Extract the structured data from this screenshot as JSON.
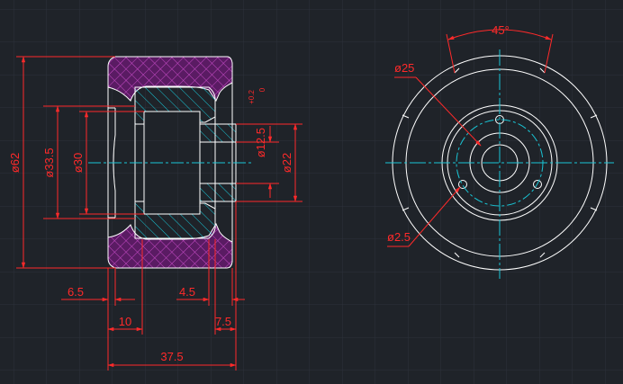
{
  "drawing": {
    "colors": {
      "background": "#1f2329",
      "grid": "#2c323a",
      "outline": "#ffffff",
      "dimension": "#ff2a2a",
      "centerline": "#19c6d6",
      "hatch_metal": "#19c6d6",
      "hatch_rubber": "#c64bc6",
      "rubber_fill": "#5a1b63"
    },
    "section_view": {
      "dimensions": {
        "d62": "ø62",
        "d33_5": "ø33.5",
        "d30": "ø30",
        "d12_5": "ø12.5",
        "d12_5_tol_upper": "+0.2",
        "d12_5_tol_lower": "0",
        "d22": "ø22",
        "w6_5": "6.5",
        "w10": "10",
        "w4_5": "4.5",
        "w7_5": "7.5",
        "w37_5": "37.5"
      }
    },
    "end_view": {
      "dimensions": {
        "angle": "45°",
        "d25": "ø25",
        "d2_5": "ø2.5"
      }
    }
  }
}
